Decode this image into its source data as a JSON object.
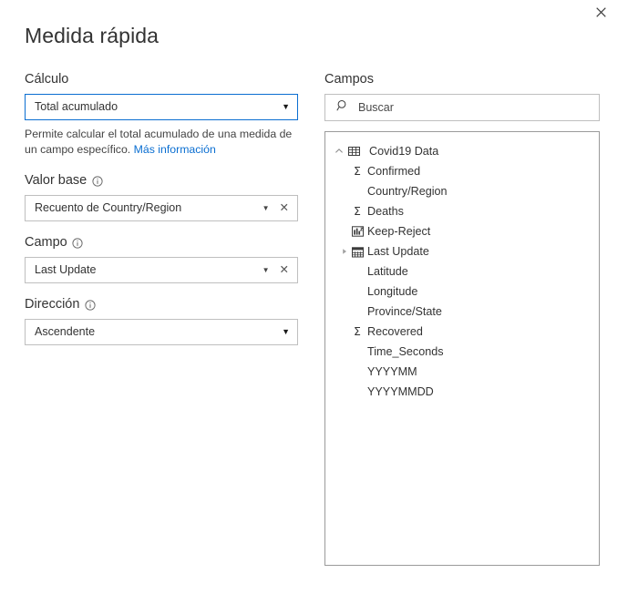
{
  "dialog": {
    "title": "Medida rápida",
    "close_label": "×"
  },
  "calculation": {
    "label": "Cálculo",
    "selected": "Total acumulado",
    "helper_text": "Permite calcular el total acumulado de una medida de un campo específico.",
    "helper_link": "Más información",
    "caret": "▼"
  },
  "base_value": {
    "label": "Valor base",
    "info_icon": "info-icon",
    "selected": "Recuento de Country/Region",
    "caret": "▼",
    "clear": "✕"
  },
  "field_section": {
    "label": "Campo",
    "info_icon": "info-icon",
    "selected": "Last Update",
    "caret": "▼",
    "clear": "✕"
  },
  "direction": {
    "label": "Dirección",
    "info_icon": "info-icon",
    "selected": "Ascendente",
    "caret": "▼"
  },
  "fields_panel": {
    "label": "Campos",
    "search_placeholder": "Buscar",
    "search_value": "",
    "search_icon": "search-icon",
    "table": {
      "name": "Covid19 Data",
      "expanded": true,
      "twisty": "⌃",
      "icon": "table-icon"
    },
    "items": [
      {
        "name": "Confirmed",
        "icon": "sigma-icon",
        "glyph": "Σ",
        "twisty": ""
      },
      {
        "name": "Country/Region",
        "icon": "none",
        "glyph": "",
        "twisty": ""
      },
      {
        "name": "Deaths",
        "icon": "sigma-icon",
        "glyph": "Σ",
        "twisty": ""
      },
      {
        "name": "Keep-Reject",
        "icon": "measure-icon",
        "glyph": "",
        "twisty": ""
      },
      {
        "name": "Last Update",
        "icon": "calendar-icon",
        "glyph": "",
        "twisty": "▶"
      },
      {
        "name": "Latitude",
        "icon": "none",
        "glyph": "",
        "twisty": ""
      },
      {
        "name": "Longitude",
        "icon": "none",
        "glyph": "",
        "twisty": ""
      },
      {
        "name": "Province/State",
        "icon": "none",
        "glyph": "",
        "twisty": ""
      },
      {
        "name": "Recovered",
        "icon": "sigma-icon",
        "glyph": "Σ",
        "twisty": ""
      },
      {
        "name": "Time_Seconds",
        "icon": "none",
        "glyph": "",
        "twisty": ""
      },
      {
        "name": "YYYYMM",
        "icon": "none",
        "glyph": "",
        "twisty": ""
      },
      {
        "name": "YYYYMMDD",
        "icon": "none",
        "glyph": "",
        "twisty": ""
      }
    ]
  },
  "colors": {
    "accent": "#0a6ed1",
    "text": "#333333",
    "border": "#bfbfbf",
    "panel_border": "#9a9a9a"
  }
}
